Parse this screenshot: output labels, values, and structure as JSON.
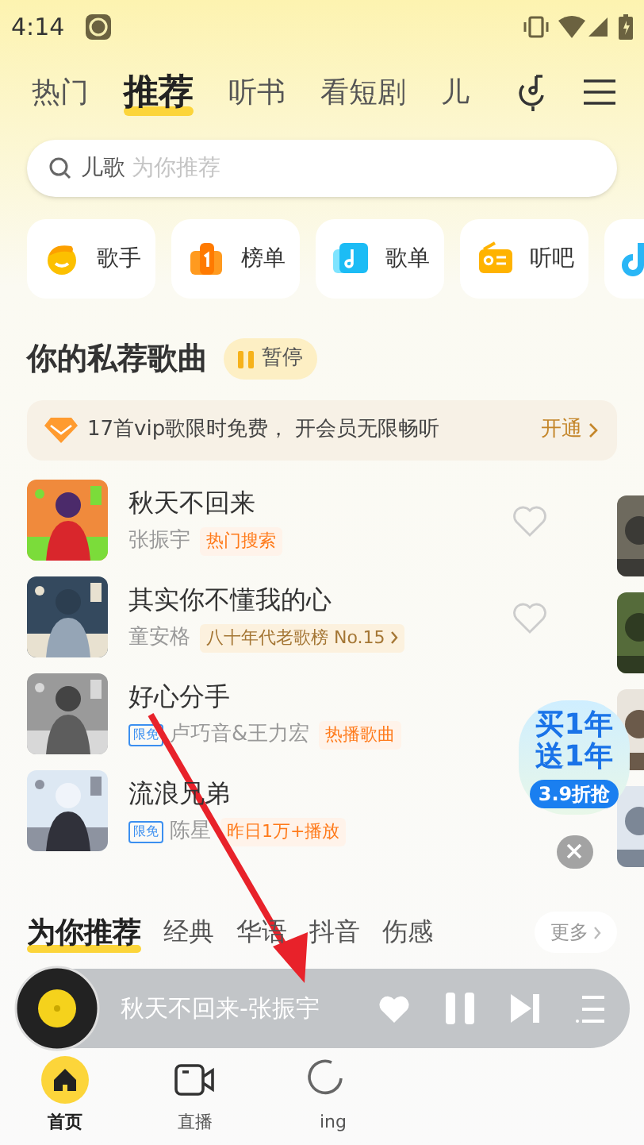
{
  "status_bar": {
    "time": "4:14"
  },
  "top_tabs": [
    {
      "label": "热门",
      "selected": false
    },
    {
      "label": "推荐",
      "selected": true
    },
    {
      "label": "听书",
      "selected": false
    },
    {
      "label": "看短剧",
      "selected": false
    },
    {
      "label": "儿",
      "selected": false
    }
  ],
  "search": {
    "value": "儿歌",
    "placeholder": "为你推荐"
  },
  "shortcuts": [
    {
      "label": "歌手",
      "kind": "singer"
    },
    {
      "label": "榜单",
      "kind": "chart"
    },
    {
      "label": "歌单",
      "kind": "playlist"
    },
    {
      "label": "听吧",
      "kind": "radio"
    },
    {
      "kind": "note"
    }
  ],
  "section": {
    "title": "你的私荐歌曲",
    "pause_button": "暂停"
  },
  "vip_banner": {
    "text": "17首vip歌限时免费， 开会员无限畅听",
    "action": "开通"
  },
  "songs": [
    {
      "title": "秋天不回来",
      "artist": "张振宇",
      "tag": {
        "text": "热门搜索",
        "kind": "hot"
      },
      "liked": false
    },
    {
      "title": "其实你不懂我的心",
      "artist": "童安格",
      "tag": {
        "text": "八十年代老歌榜 No.15",
        "kind": "chart"
      },
      "liked": false
    },
    {
      "title": "好心分手",
      "artist": "卢巧音&王力宏",
      "tag": {
        "text": "热播歌曲",
        "kind": "hot"
      },
      "free_badge": "限免"
    },
    {
      "title": "流浪兄弟",
      "artist": "陈星",
      "tag": {
        "text": "昨日1万+播放",
        "kind": "hot"
      },
      "free_badge": "限免"
    }
  ],
  "promo": {
    "line_1": "买1年",
    "line_2": "送1年",
    "price": "3.9折抢"
  },
  "sub_tabs": [
    {
      "label": "为你推荐",
      "selected": true
    },
    {
      "label": "经典",
      "selected": false
    },
    {
      "label": "华语",
      "selected": false
    },
    {
      "label": "抖音",
      "selected": false
    },
    {
      "label": "伤感",
      "selected": false
    }
  ],
  "more_button": "更多",
  "mini_player": {
    "now_playing": "秋天不回来-张振宇",
    "playing": true
  },
  "bottom_nav": [
    {
      "label": "首页",
      "kind": "home",
      "selected": true
    },
    {
      "label": "直播",
      "kind": "live",
      "selected": false
    },
    {
      "label": "ing",
      "kind": "listening",
      "selected": false
    }
  ]
}
